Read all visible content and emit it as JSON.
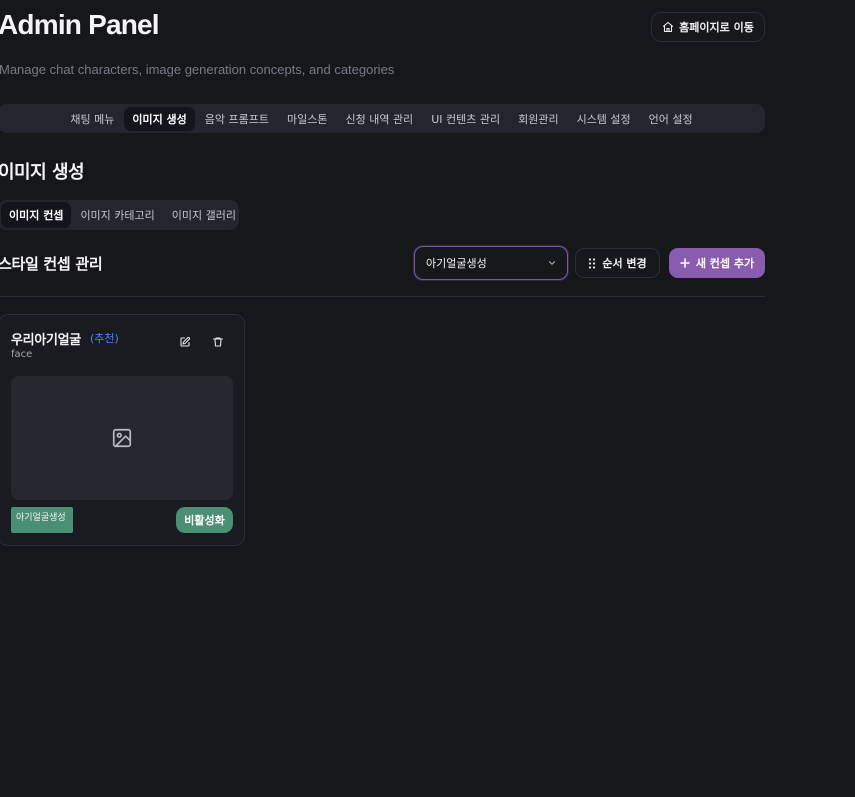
{
  "header": {
    "title": "Admin Panel",
    "subtitle": "Manage chat characters, image generation concepts, and categories",
    "home_button": {
      "label": "홈페이지로 이동",
      "icon": "home-icon"
    }
  },
  "main_nav": {
    "items": [
      {
        "label": "채팅 메뉴",
        "active": false
      },
      {
        "label": "이미지 생성",
        "active": true
      },
      {
        "label": "음악 프롬프트",
        "active": false
      },
      {
        "label": "마일스톤",
        "active": false
      },
      {
        "label": "신청 내역 관리",
        "active": false
      },
      {
        "label": "UI 컨텐츠 관리",
        "active": false
      },
      {
        "label": "회원관리",
        "active": false
      },
      {
        "label": "시스템 설정",
        "active": false
      },
      {
        "label": "언어 설정",
        "active": false
      }
    ]
  },
  "section": {
    "title": "이미지 생성",
    "sub_tabs": [
      {
        "label": "이미지 컨셉",
        "active": true
      },
      {
        "label": "이미지 카테고리",
        "active": false
      },
      {
        "label": "이미지 갤러리",
        "active": false
      }
    ]
  },
  "toolbar": {
    "title": "스타일 컨셉 관리",
    "filter_value": "아기얼굴생성",
    "reorder_label": "순서 변경",
    "add_label": "새 컨셉 추가"
  },
  "concepts": [
    {
      "name": "우리아기얼굴",
      "badge": "(추천)",
      "key": "face",
      "category_tag": "아기얼굴생성",
      "toggle_label": "비활성화"
    }
  ],
  "colors": {
    "background": "#16171b",
    "accent_purple": "#8a5cb0",
    "status_green": "#4a8f74",
    "badge_blue": "#4f86ff"
  }
}
